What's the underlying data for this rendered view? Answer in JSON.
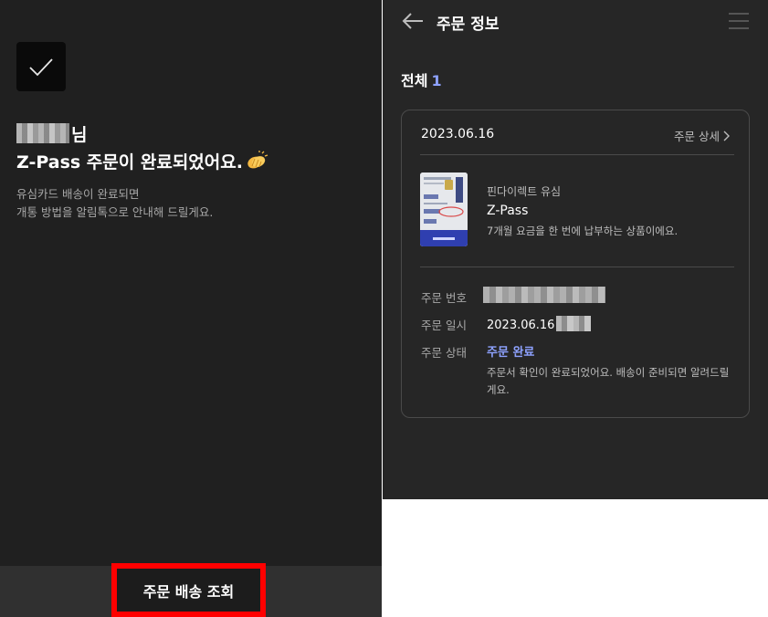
{
  "completion": {
    "honorific": "님",
    "title": "Z-Pass 주문이 완료되었어요.",
    "notice_line1": "유심카드 배송이 완료되면",
    "notice_line2": "개통 방법을 알림톡으로 안내해 드릴게요.",
    "track_button": "주문 배송 조회"
  },
  "header": {
    "title": "주문 정보",
    "back_icon": "arrow-left-icon",
    "menu_icon": "menu-icon"
  },
  "summary": {
    "total_label": "전체",
    "total_count": "1"
  },
  "order": {
    "date": "2023.06.16",
    "detail_link": "주문 상세",
    "product": {
      "brand": "핀다이렉트 유심",
      "name": "Z-Pass",
      "description": "7개월 요금을 한 번에 납부하는 상품이에요."
    },
    "number_label": "주문 번호",
    "date_label": "주문 일시",
    "date_value": "2023.06.16",
    "status_label": "주문 상태",
    "status_value": "주문 완료",
    "status_description": "주문서 확인이 완료되었어요. 배송이 준비되면 알려드릴게요."
  },
  "colors": {
    "accent": "#8ea2ff",
    "highlight_box": "#ff0000"
  }
}
